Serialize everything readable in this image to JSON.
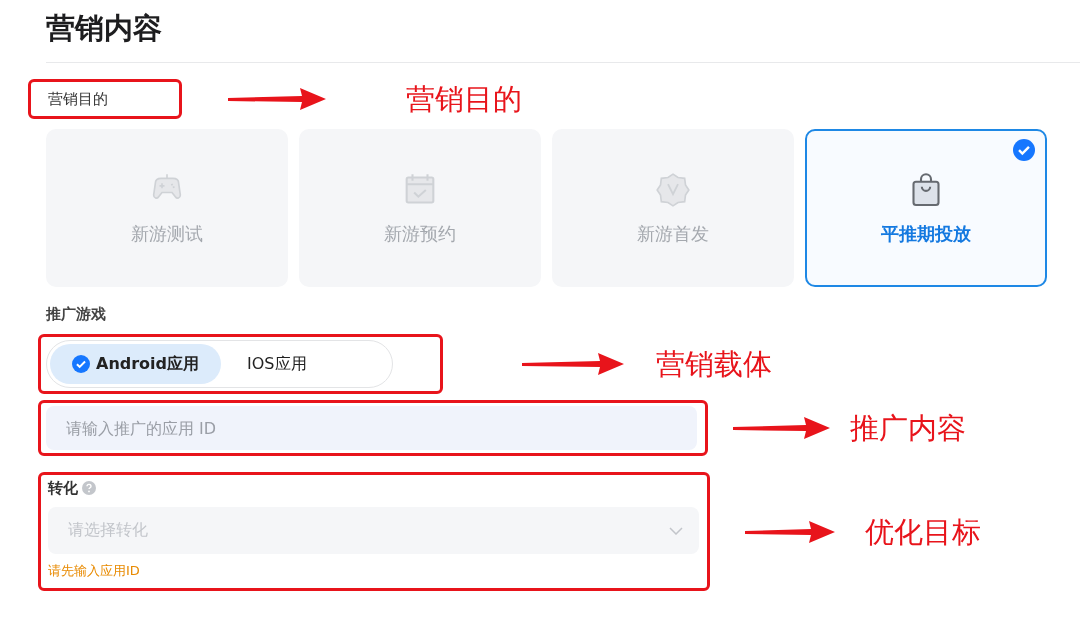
{
  "title": "营销内容",
  "purpose": {
    "label": "营销目的",
    "annotation": "营销目的",
    "cards": [
      {
        "label": "新游测试",
        "selected": false
      },
      {
        "label": "新游预约",
        "selected": false
      },
      {
        "label": "新游首发",
        "selected": false
      },
      {
        "label": "平推期投放",
        "selected": true
      }
    ]
  },
  "platform": {
    "label": "推广游戏",
    "annotation": "营销载体",
    "options": [
      {
        "label": "Android应用",
        "selected": true
      },
      {
        "label": "IOS应用",
        "selected": false
      }
    ]
  },
  "app_id": {
    "placeholder": "请输入推广的应用 ID",
    "annotation": "推广内容"
  },
  "conversion": {
    "label": "转化",
    "placeholder": "请选择转化",
    "hint": "请先输入应用ID",
    "annotation": "优化目标"
  }
}
